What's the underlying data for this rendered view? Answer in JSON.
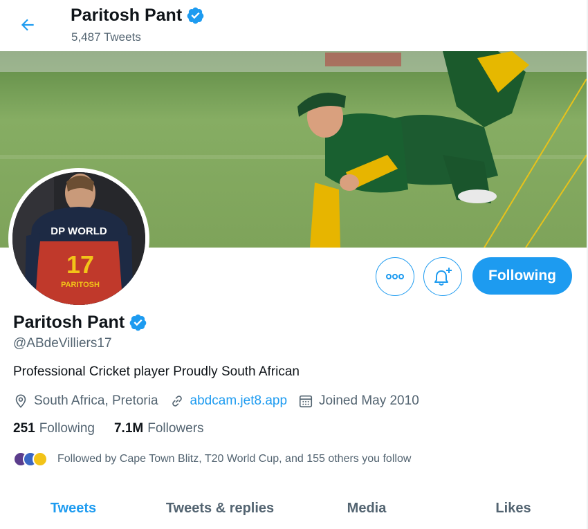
{
  "header": {
    "name": "Paritosh Pant",
    "tweet_count": "5,487 Tweets"
  },
  "profile": {
    "name": "Paritosh Pant",
    "handle": "@ABdeVilliers17",
    "bio": "Professional Cricket player Proudly South African",
    "location": "South Africa, Pretoria",
    "website": "abdcam.jet8.app",
    "joined": "Joined May 2010",
    "following_count": "251",
    "following_label": "Following",
    "followers_count": "7.1M",
    "followers_label": "Followers",
    "followed_by": "Followed by Cape Town Blitz, T20 World Cup, and 155 others you follow"
  },
  "avatar": {
    "jersey_sponsor": "DP WORLD",
    "jersey_number": "17",
    "jersey_name": "PARITOSH"
  },
  "actions": {
    "follow_label": "Following"
  },
  "tabs": [
    {
      "label": "Tweets",
      "active": true
    },
    {
      "label": "Tweets & replies",
      "active": false
    },
    {
      "label": "Media",
      "active": false
    },
    {
      "label": "Likes",
      "active": false
    }
  ],
  "colors": {
    "accent": "#1d9bf0",
    "text_primary": "#0f1419",
    "text_secondary": "#536471"
  },
  "icons": {
    "back": "arrow-left-icon",
    "verified": "verified-badge-icon",
    "more": "more-dots-icon",
    "notify": "bell-plus-icon",
    "location": "location-pin-icon",
    "link": "link-icon",
    "calendar": "calendar-icon"
  }
}
